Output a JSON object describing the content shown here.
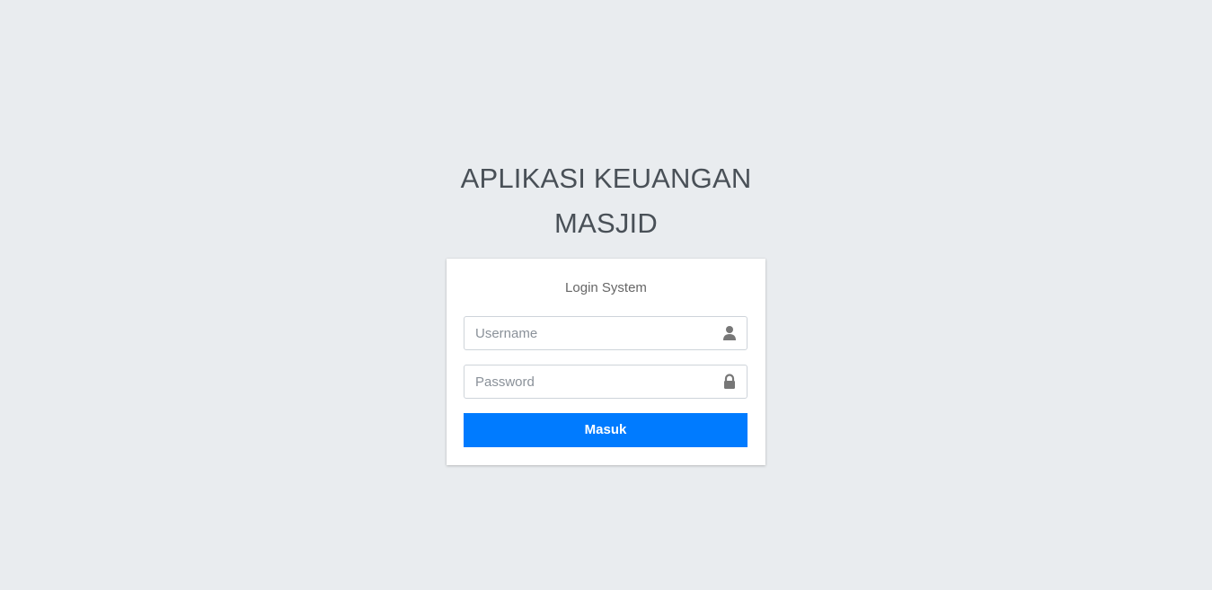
{
  "logo": {
    "line1": "APLIKASI KEUANGAN",
    "line2": "MASJID"
  },
  "login": {
    "message": "Login System",
    "username": {
      "placeholder": "Username",
      "value": "",
      "icon": "user-icon"
    },
    "password": {
      "placeholder": "Password",
      "value": "",
      "icon": "lock-icon"
    },
    "submit_label": "Masuk"
  },
  "colors": {
    "background": "#e9ecef",
    "card": "#ffffff",
    "primary": "#007bff",
    "icon": "#777777"
  }
}
